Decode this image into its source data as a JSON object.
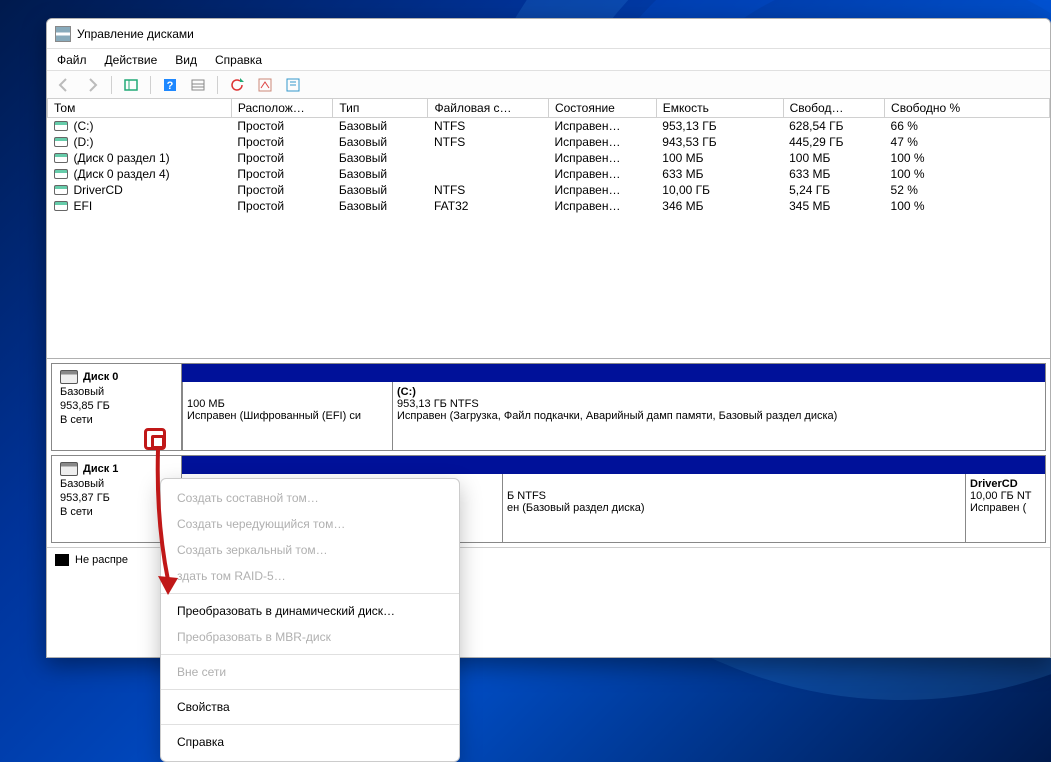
{
  "title": "Управление дисками",
  "menu": {
    "file": "Файл",
    "action": "Действие",
    "view": "Вид",
    "help": "Справка"
  },
  "columns": {
    "volume": "Том",
    "layout": "Располож…",
    "type": "Тип",
    "fs": "Файловая с…",
    "status": "Состояние",
    "capacity": "Емкость",
    "free": "Свобод…",
    "free_pct": "Свободно %"
  },
  "volumes": [
    {
      "name": "(C:)",
      "layout": "Простой",
      "type": "Базовый",
      "fs": "NTFS",
      "status": "Исправен…",
      "capacity": "953,13 ГБ",
      "free": "628,54 ГБ",
      "free_pct": "66 %"
    },
    {
      "name": "(D:)",
      "layout": "Простой",
      "type": "Базовый",
      "fs": "NTFS",
      "status": "Исправен…",
      "capacity": "943,53 ГБ",
      "free": "445,29 ГБ",
      "free_pct": "47 %"
    },
    {
      "name": "(Диск 0 раздел 1)",
      "layout": "Простой",
      "type": "Базовый",
      "fs": "",
      "status": "Исправен…",
      "capacity": "100 МБ",
      "free": "100 МБ",
      "free_pct": "100 %"
    },
    {
      "name": "(Диск 0 раздел 4)",
      "layout": "Простой",
      "type": "Базовый",
      "fs": "",
      "status": "Исправен…",
      "capacity": "633 МБ",
      "free": "633 МБ",
      "free_pct": "100 %"
    },
    {
      "name": "DriverCD",
      "layout": "Простой",
      "type": "Базовый",
      "fs": "NTFS",
      "status": "Исправен…",
      "capacity": "10,00 ГБ",
      "free": "5,24 ГБ",
      "free_pct": "52 %"
    },
    {
      "name": "EFI",
      "layout": "Простой",
      "type": "Базовый",
      "fs": "FAT32",
      "status": "Исправен…",
      "capacity": "346 МБ",
      "free": "345 МБ",
      "free_pct": "100 %"
    }
  ],
  "disk0": {
    "name": "Диск 0",
    "type": "Базовый",
    "size": "953,85 ГБ",
    "state": "В сети",
    "part1_size": "100 МБ",
    "part1_status": "Исправен (Шифрованный (EFI) си",
    "partC_name": "(C:)",
    "partC_size": "953,13 ГБ NTFS",
    "partC_status": "Исправен (Загрузка, Файл подкачки, Аварийный дамп памяти, Базовый раздел диска)"
  },
  "disk1": {
    "name": "Диск 1",
    "type": "Базовый",
    "size": "953,87 ГБ",
    "state": "В сети",
    "partD_size_suffix": "Б NTFS",
    "partD_status_suffix": "ен (Базовый раздел диска)",
    "driver_name": "DriverCD",
    "driver_size": "10,00 ГБ NT",
    "driver_status": "Исправен ("
  },
  "legend": "Не распре",
  "ctx": {
    "spanned": "Создать составной том…",
    "striped": "Создать чередующийся том…",
    "mirrored": "Создать зеркальный том…",
    "raid5": "здать том RAID-5…",
    "to_dynamic": "Преобразовать в динамический диск…",
    "to_mbr": "Преобразовать в MBR-диск",
    "offline": "Вне сети",
    "properties": "Свойства",
    "help": "Справка"
  }
}
